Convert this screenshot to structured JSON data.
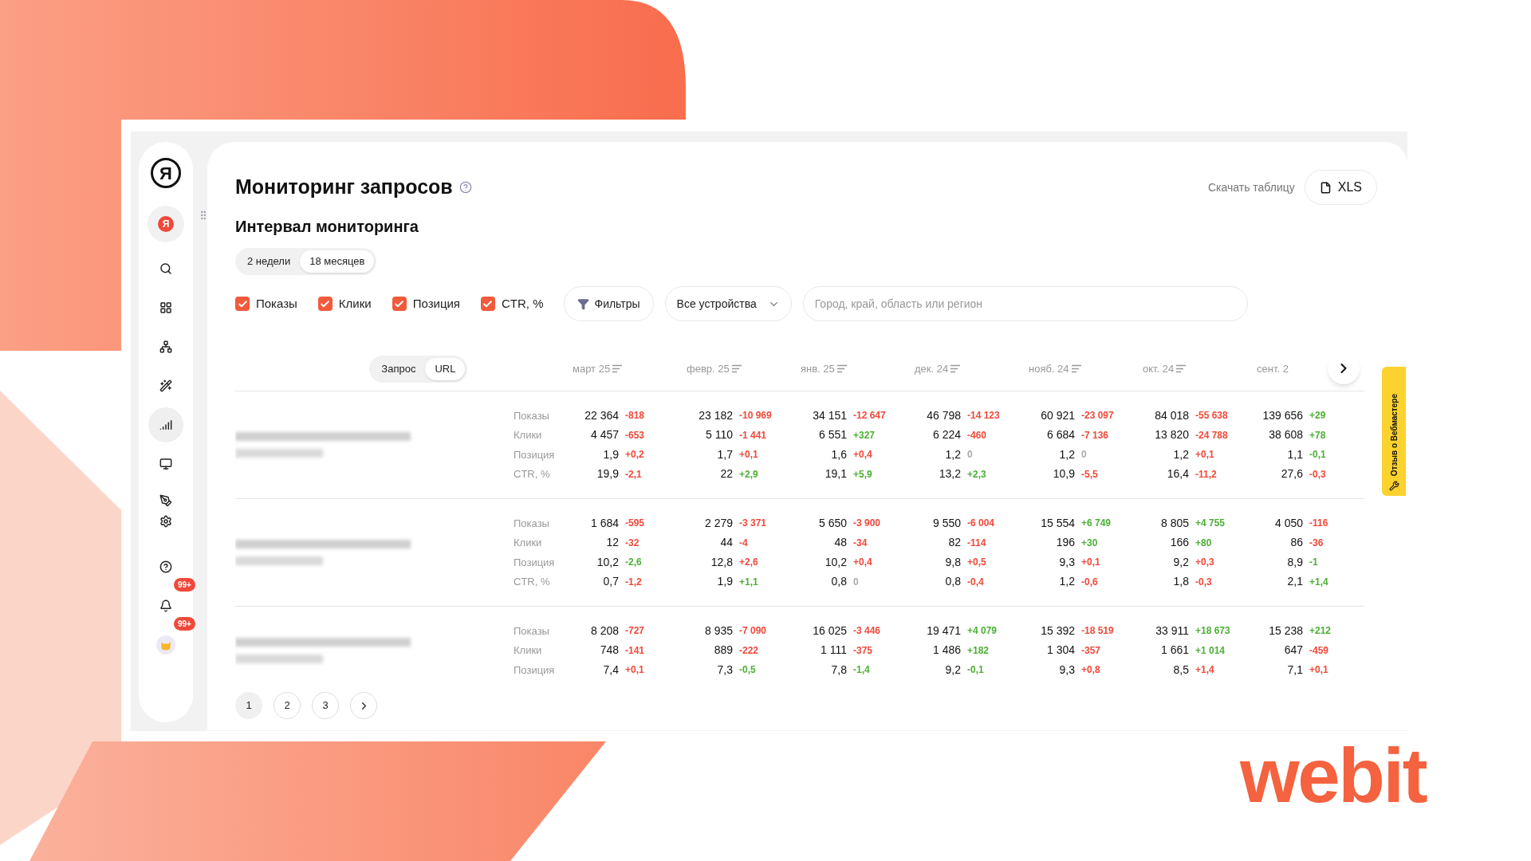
{
  "brand": {
    "logo": "webit"
  },
  "sidebar": {
    "logo_letter": "Я",
    "account_letter": "Я",
    "items": [
      {
        "kind": "search",
        "selected": false
      },
      {
        "kind": "grid",
        "selected": false
      },
      {
        "kind": "sitemap",
        "selected": false
      },
      {
        "kind": "magic",
        "selected": false
      },
      {
        "kind": "chart",
        "selected": true
      },
      {
        "kind": "monitor",
        "selected": false
      },
      {
        "kind": "tools",
        "selected": false
      },
      {
        "kind": "help",
        "selected": false
      },
      {
        "kind": "bell",
        "selected": false,
        "badge": "99+"
      },
      {
        "kind": "avatar",
        "selected": false,
        "badge": "99+"
      }
    ]
  },
  "header": {
    "title": "Мониторинг запросов",
    "download_label": "Скачать таблицу",
    "download_button": "XLS"
  },
  "interval": {
    "title": "Интервал мониторинга",
    "options": [
      {
        "label": "2 недели",
        "selected": false
      },
      {
        "label": "18 месяцев",
        "selected": true
      }
    ]
  },
  "filters": {
    "metrics": [
      {
        "label": "Показы",
        "checked": true
      },
      {
        "label": "Клики",
        "checked": true
      },
      {
        "label": "Позиция",
        "checked": true
      },
      {
        "label": "CTR, %",
        "checked": true
      }
    ],
    "filter_button": "Фильтры",
    "device_select": "Все устройства",
    "region_search": {
      "placeholder": "Город, край, область или регион"
    }
  },
  "table": {
    "mode_tabs": [
      {
        "label": "Запрос",
        "selected": false
      },
      {
        "label": "URL",
        "selected": true
      }
    ],
    "columns": [
      "март 25",
      "февр. 25",
      "янв. 25",
      "дек. 24",
      "нояб. 24",
      "окт. 24",
      "сент. 2"
    ],
    "groups": [
      {
        "query_hidden": true,
        "metrics": [
          {
            "label": "Показы",
            "cells": [
              {
                "v": "22 364",
                "d": "-818",
                "color": "#f0493a"
              },
              {
                "v": "23 182",
                "d": "-10 969",
                "color": "#f0493a"
              },
              {
                "v": "34 151",
                "d": "-12 647",
                "color": "#f0493a"
              },
              {
                "v": "46 798",
                "d": "-14 123",
                "color": "#f0493a"
              },
              {
                "v": "60 921",
                "d": "-23 097",
                "color": "#f0493a"
              },
              {
                "v": "84 018",
                "d": "-55 638",
                "color": "#f0493a"
              },
              {
                "v": "139 656",
                "d": "+29",
                "color": "#4caf35"
              }
            ]
          },
          {
            "label": "Клики",
            "cells": [
              {
                "v": "4 457",
                "d": "-653",
                "color": "#f0493a"
              },
              {
                "v": "5 110",
                "d": "-1 441",
                "color": "#f0493a"
              },
              {
                "v": "6 551",
                "d": "+327",
                "color": "#4caf35"
              },
              {
                "v": "6 224",
                "d": "-460",
                "color": "#f0493a"
              },
              {
                "v": "6 684",
                "d": "-7 136",
                "color": "#f0493a"
              },
              {
                "v": "13 820",
                "d": "-24 788",
                "color": "#f0493a"
              },
              {
                "v": "38 608",
                "d": "+78",
                "color": "#4caf35"
              }
            ]
          },
          {
            "label": "Позиция",
            "cells": [
              {
                "v": "1,9",
                "d": "+0,2",
                "color": "#f0493a"
              },
              {
                "v": "1,7",
                "d": "+0,1",
                "color": "#f0493a"
              },
              {
                "v": "1,6",
                "d": "+0,4",
                "color": "#f0493a"
              },
              {
                "v": "1,2",
                "d": "0",
                "color": "#aaaaaa"
              },
              {
                "v": "1,2",
                "d": "0",
                "color": "#aaaaaa"
              },
              {
                "v": "1,2",
                "d": "+0,1",
                "color": "#f0493a"
              },
              {
                "v": "1,1",
                "d": "-0,1",
                "color": "#4caf35"
              }
            ]
          },
          {
            "label": "CTR, %",
            "cells": [
              {
                "v": "19,9",
                "d": "-2,1",
                "color": "#f0493a"
              },
              {
                "v": "22",
                "d": "+2,9",
                "color": "#4caf35"
              },
              {
                "v": "19,1",
                "d": "+5,9",
                "color": "#4caf35"
              },
              {
                "v": "13,2",
                "d": "+2,3",
                "color": "#4caf35"
              },
              {
                "v": "10,9",
                "d": "-5,5",
                "color": "#f0493a"
              },
              {
                "v": "16,4",
                "d": "-11,2",
                "color": "#f0493a"
              },
              {
                "v": "27,6",
                "d": "-0,3",
                "color": "#f0493a"
              }
            ]
          }
        ]
      },
      {
        "query_hidden": true,
        "metrics": [
          {
            "label": "Показы",
            "cells": [
              {
                "v": "1 684",
                "d": "-595",
                "color": "#f0493a"
              },
              {
                "v": "2 279",
                "d": "-3 371",
                "color": "#f0493a"
              },
              {
                "v": "5 650",
                "d": "-3 900",
                "color": "#f0493a"
              },
              {
                "v": "9 550",
                "d": "-6 004",
                "color": "#f0493a"
              },
              {
                "v": "15 554",
                "d": "+6 749",
                "color": "#4caf35"
              },
              {
                "v": "8 805",
                "d": "+4 755",
                "color": "#4caf35"
              },
              {
                "v": "4 050",
                "d": "-116",
                "color": "#f0493a"
              }
            ]
          },
          {
            "label": "Клики",
            "cells": [
              {
                "v": "12",
                "d": "-32",
                "color": "#f0493a"
              },
              {
                "v": "44",
                "d": "-4",
                "color": "#f0493a"
              },
              {
                "v": "48",
                "d": "-34",
                "color": "#f0493a"
              },
              {
                "v": "82",
                "d": "-114",
                "color": "#f0493a"
              },
              {
                "v": "196",
                "d": "+30",
                "color": "#4caf35"
              },
              {
                "v": "166",
                "d": "+80",
                "color": "#4caf35"
              },
              {
                "v": "86",
                "d": "-36",
                "color": "#f0493a"
              }
            ]
          },
          {
            "label": "Позиция",
            "cells": [
              {
                "v": "10,2",
                "d": "-2,6",
                "color": "#4caf35"
              },
              {
                "v": "12,8",
                "d": "+2,6",
                "color": "#f0493a"
              },
              {
                "v": "10,2",
                "d": "+0,4",
                "color": "#f0493a"
              },
              {
                "v": "9,8",
                "d": "+0,5",
                "color": "#f0493a"
              },
              {
                "v": "9,3",
                "d": "+0,1",
                "color": "#f0493a"
              },
              {
                "v": "9,2",
                "d": "+0,3",
                "color": "#f0493a"
              },
              {
                "v": "8,9",
                "d": "-1",
                "color": "#4caf35"
              }
            ]
          },
          {
            "label": "CTR, %",
            "cells": [
              {
                "v": "0,7",
                "d": "-1,2",
                "color": "#f0493a"
              },
              {
                "v": "1,9",
                "d": "+1,1",
                "color": "#4caf35"
              },
              {
                "v": "0,8",
                "d": "0",
                "color": "#aaaaaa"
              },
              {
                "v": "0,8",
                "d": "-0,4",
                "color": "#f0493a"
              },
              {
                "v": "1,2",
                "d": "-0,6",
                "color": "#f0493a"
              },
              {
                "v": "1,8",
                "d": "-0,3",
                "color": "#f0493a"
              },
              {
                "v": "2,1",
                "d": "+1,4",
                "color": "#4caf35"
              }
            ]
          }
        ]
      },
      {
        "query_hidden": true,
        "metrics": [
          {
            "label": "Показы",
            "cells": [
              {
                "v": "8 208",
                "d": "-727",
                "color": "#f0493a"
              },
              {
                "v": "8 935",
                "d": "-7 090",
                "color": "#f0493a"
              },
              {
                "v": "16 025",
                "d": "-3 446",
                "color": "#f0493a"
              },
              {
                "v": "19 471",
                "d": "+4 079",
                "color": "#4caf35"
              },
              {
                "v": "15 392",
                "d": "-18 519",
                "color": "#f0493a"
              },
              {
                "v": "33 911",
                "d": "+18 673",
                "color": "#4caf35"
              },
              {
                "v": "15 238",
                "d": "+212",
                "color": "#4caf35"
              }
            ]
          },
          {
            "label": "Клики",
            "cells": [
              {
                "v": "748",
                "d": "-141",
                "color": "#f0493a"
              },
              {
                "v": "889",
                "d": "-222",
                "color": "#f0493a"
              },
              {
                "v": "1 111",
                "d": "-375",
                "color": "#f0493a"
              },
              {
                "v": "1 486",
                "d": "+182",
                "color": "#4caf35"
              },
              {
                "v": "1 304",
                "d": "-357",
                "color": "#f0493a"
              },
              {
                "v": "1 661",
                "d": "+1 014",
                "color": "#4caf35"
              },
              {
                "v": "647",
                "d": "-459",
                "color": "#f0493a"
              }
            ]
          },
          {
            "label": "Позиция",
            "cells": [
              {
                "v": "7,4",
                "d": "+0,1",
                "color": "#f0493a"
              },
              {
                "v": "7,3",
                "d": "-0,5",
                "color": "#4caf35"
              },
              {
                "v": "7,8",
                "d": "-1,4",
                "color": "#4caf35"
              },
              {
                "v": "9,2",
                "d": "-0,1",
                "color": "#4caf35"
              },
              {
                "v": "9,3",
                "d": "+0,8",
                "color": "#f0493a"
              },
              {
                "v": "8,5",
                "d": "+1,4",
                "color": "#f0493a"
              },
              {
                "v": "7,1",
                "d": "+0,1",
                "color": "#f0493a"
              }
            ]
          }
        ]
      }
    ]
  },
  "pagination": {
    "pages": [
      {
        "label": "1",
        "selected": true
      },
      {
        "label": "2",
        "selected": false
      },
      {
        "label": "3",
        "selected": false
      }
    ]
  },
  "feedback_tab": "Отзыв о Вебмастере"
}
